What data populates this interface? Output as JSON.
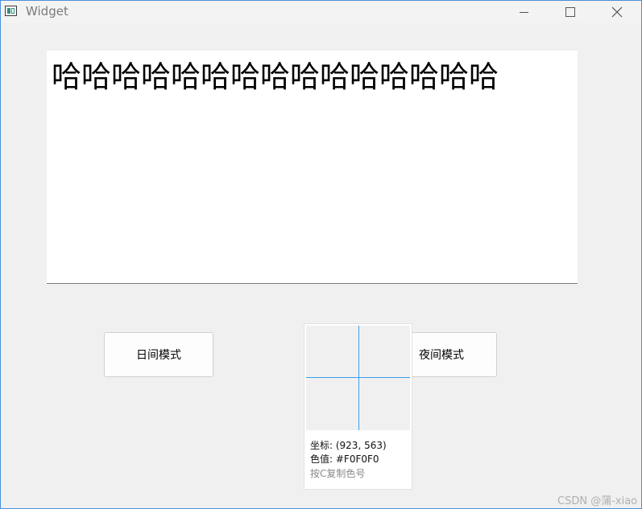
{
  "window": {
    "title": "Widget"
  },
  "text_area": {
    "content": "哈哈哈哈哈哈哈哈哈哈哈哈哈哈哈"
  },
  "buttons": {
    "day_mode": "日间模式",
    "night_mode": "夜间模式"
  },
  "color_picker": {
    "coord_text": "坐标: (923, 563)",
    "color_text": "色值: #F0F0F0",
    "hint_text": "按C复制色号",
    "sampled_color": "#F0F0F0",
    "crosshair_color": "#3aa0e6"
  },
  "watermark": "CSDN @蒲-xiao"
}
